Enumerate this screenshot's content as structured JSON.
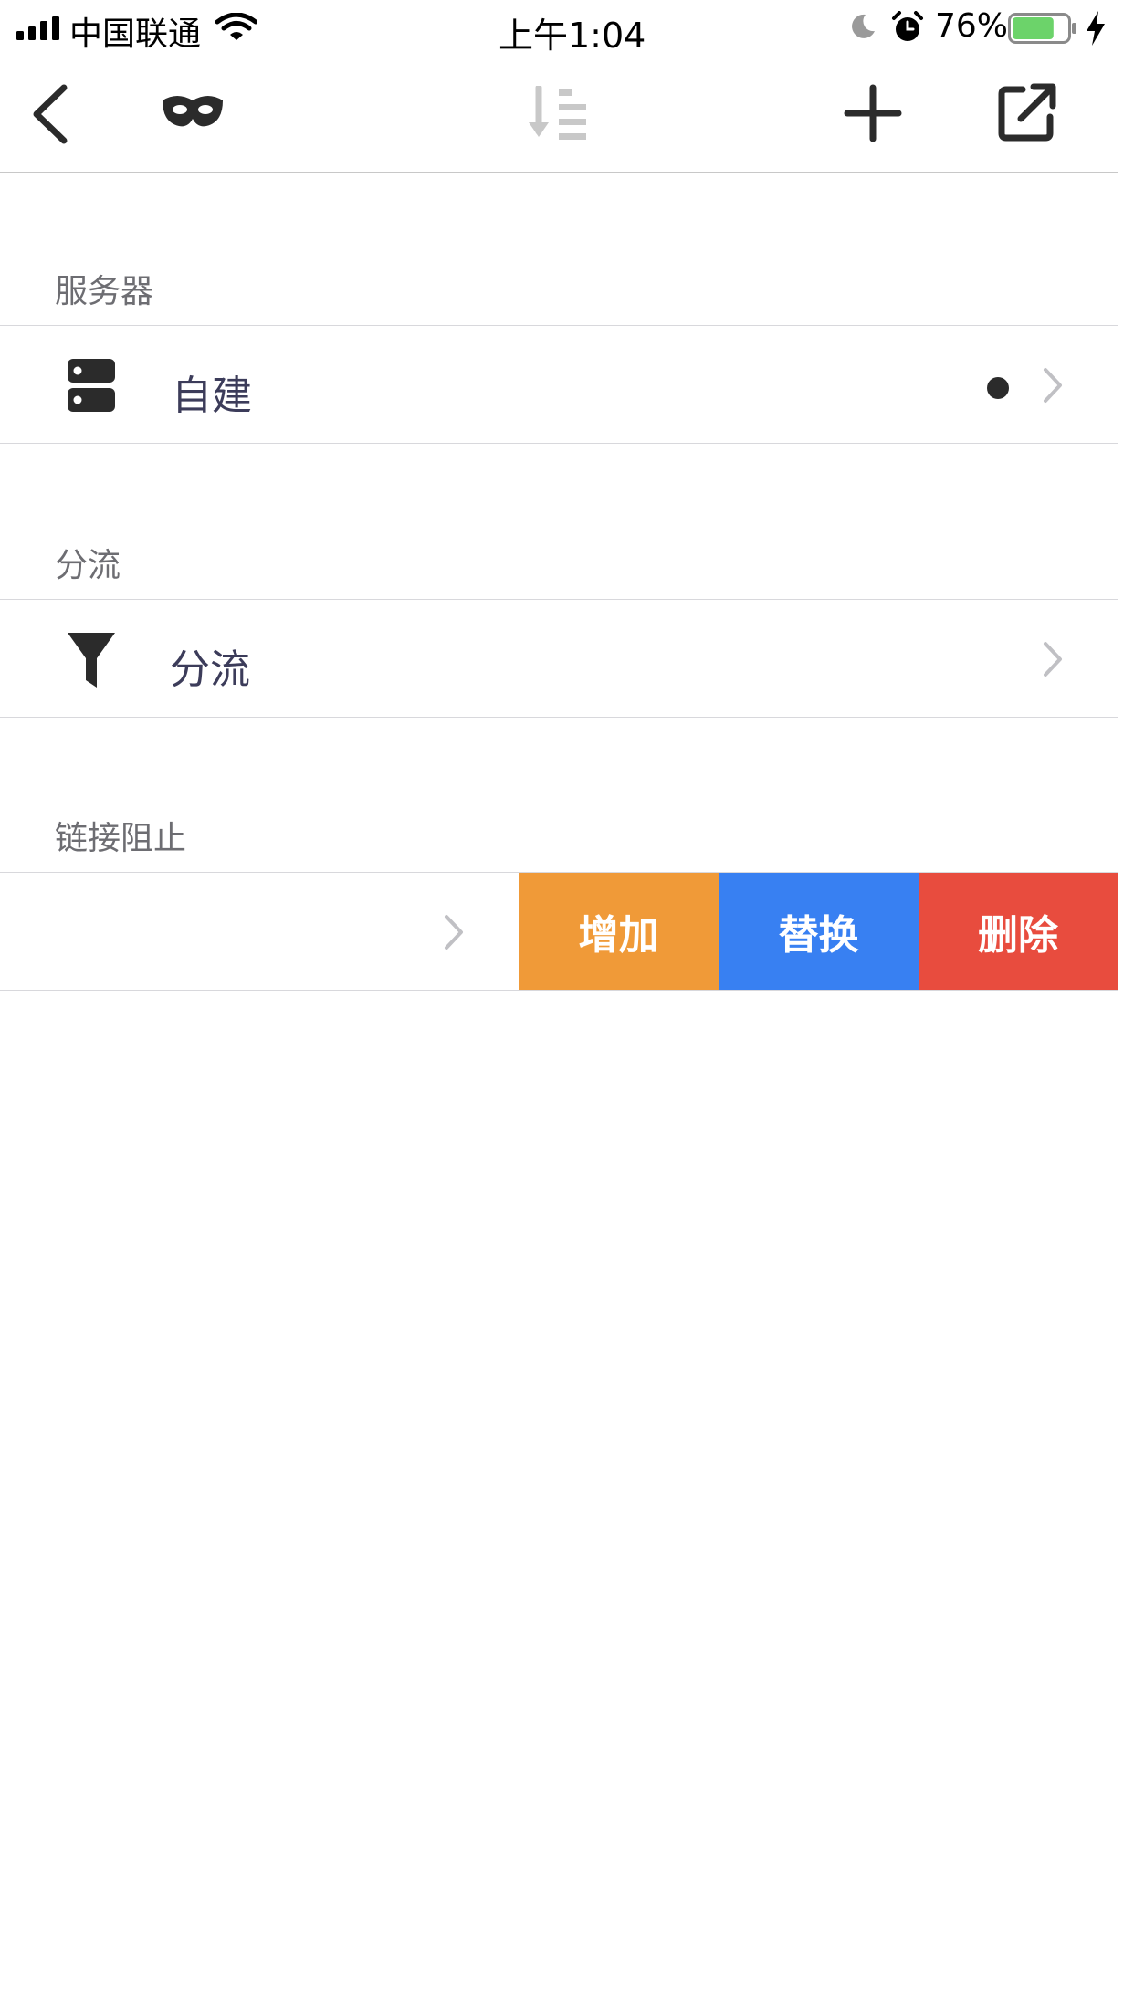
{
  "status_bar": {
    "carrier": "中国联通",
    "time": "上午1:04",
    "battery": "76%",
    "battery_level": 0.76
  },
  "nav": {
    "icons": [
      "back-chevron-icon",
      "mask-icon",
      "sort-icon",
      "plus-icon",
      "share-icon"
    ]
  },
  "sections": {
    "server": {
      "header": "服务器",
      "row_label": "自建",
      "icon": "server-icon"
    },
    "routing": {
      "header": "分流",
      "row_label": "分流",
      "icon": "funnel-icon"
    },
    "block": {
      "header": "链接阻止",
      "actions": {
        "add": "增加",
        "replace": "替换",
        "delete": "删除"
      }
    }
  },
  "colors": {
    "add": "#f09a38",
    "replace": "#3880f2",
    "delete": "#e84c3e",
    "battery_fill": "#6cd36a"
  }
}
